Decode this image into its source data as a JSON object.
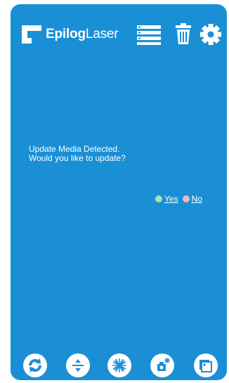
{
  "brand": {
    "name_bold": "Epilog",
    "name_light": "Laser"
  },
  "header": {
    "icons": [
      "list-icon",
      "trash-icon",
      "gear-icon"
    ]
  },
  "dialog": {
    "line1": "Update Media Detected.",
    "line2": "Would you like to update?",
    "yes_label": "Yes",
    "no_label": "No",
    "yes_color": "#a9e0b0",
    "no_color": "#f2b8bf"
  },
  "toolbar": {
    "icons": [
      "refresh-icon",
      "jog-icon",
      "laser-icon",
      "autofocus-icon",
      "home-icon"
    ]
  },
  "colors": {
    "panel": "#1a8fd6",
    "accent": "#ffffff"
  }
}
